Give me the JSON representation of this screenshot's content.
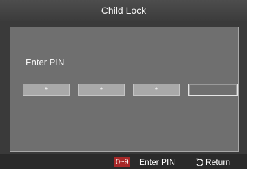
{
  "dialog": {
    "title": "Child Lock",
    "prompt": "Enter PIN",
    "pin_fields": [
      {
        "mask": "*",
        "state": "filled"
      },
      {
        "mask": "*",
        "state": "filled"
      },
      {
        "mask": "*",
        "state": "filled"
      },
      {
        "mask": "",
        "state": "active"
      }
    ]
  },
  "footer": {
    "key_range": "0~9",
    "enter_label": "Enter PIN",
    "return_label": "Return",
    "return_icon": "return-icon"
  },
  "colors": {
    "background": "#3a3a3a",
    "panel": "#6f6f6f",
    "key_badge": "#a82828"
  }
}
